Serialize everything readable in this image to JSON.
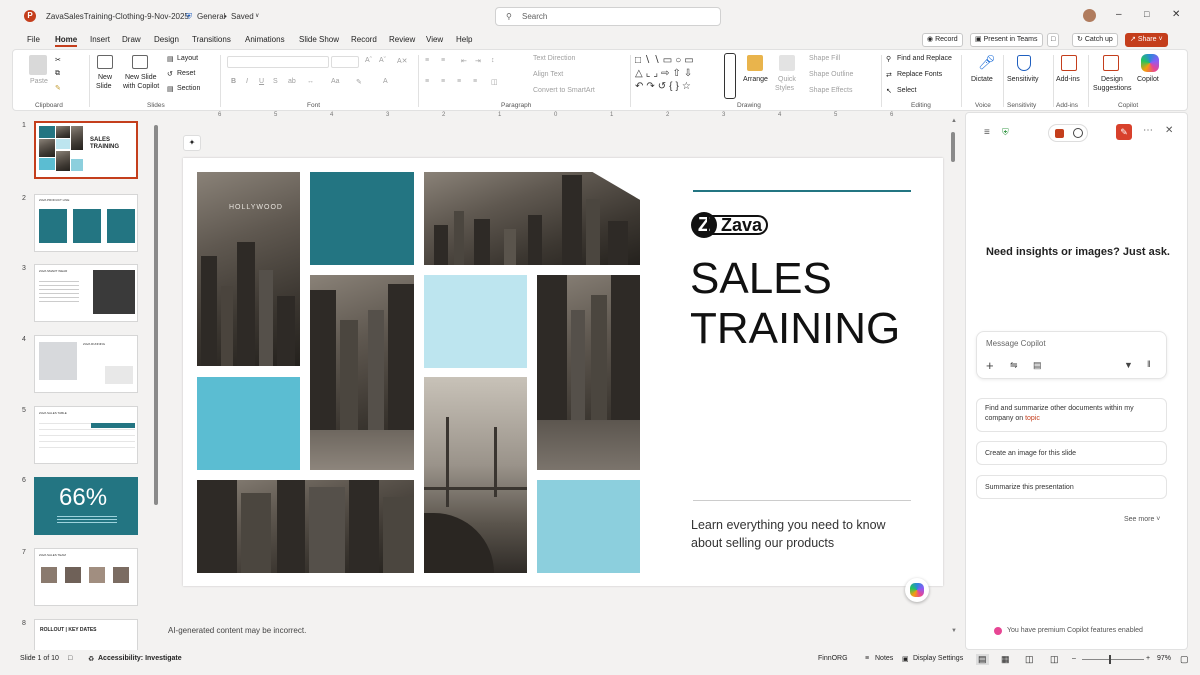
{
  "titlebar": {
    "filename": "ZavaSalesTraining-Clothing-9-Nov-2025",
    "sensitivity": "General",
    "saved": "Saved",
    "search_placeholder": "Search",
    "app_initial": "P"
  },
  "tabs": [
    "File",
    "Home",
    "Insert",
    "Draw",
    "Design",
    "Transitions",
    "Animations",
    "Slide Show",
    "Record",
    "Review",
    "View",
    "Help"
  ],
  "actions": {
    "record": "Record",
    "teams": "Present in Teams",
    "catchup": "Catch up",
    "share": "Share"
  },
  "ribbon": {
    "clipboard": {
      "paste": "Paste",
      "label": "Clipboard"
    },
    "slides": {
      "new_slide": "New",
      "new_slide2": "Slide",
      "copilot_slide": "New Slide",
      "copilot_slide2": "with Copilot",
      "layout": "Layout",
      "reset": "Reset",
      "section": "Section",
      "label": "Slides"
    },
    "font": {
      "label": "Font"
    },
    "paragraph": {
      "text_direction": "Text Direction",
      "align_text": "Align Text",
      "smartart": "Convert to SmartArt",
      "label": "Paragraph"
    },
    "drawing": {
      "arrange": "Arrange",
      "quick_styles": "Quick",
      "quick_styles2": "Styles",
      "shape_fill": "Shape Fill",
      "shape_outline": "Shape Outline",
      "shape_effects": "Shape Effects",
      "label": "Drawing"
    },
    "editing": {
      "find": "Find and Replace",
      "replace": "Replace Fonts",
      "select": "Select",
      "label": "Editing"
    },
    "voice": {
      "dictate": "Dictate",
      "label": "Voice"
    },
    "sensitivity": {
      "btn": "Sensitivity",
      "label": "Sensitivity"
    },
    "addins": {
      "btn": "Add-ins",
      "label": "Add-ins"
    },
    "copilot": {
      "designer": "Design",
      "designer2": "Suggestions",
      "copilot": "Copilot",
      "label": "Copilot"
    }
  },
  "ruler": [
    "6",
    "5",
    "4",
    "3",
    "2",
    "1",
    "0",
    "1",
    "2",
    "3",
    "4",
    "5",
    "6"
  ],
  "thumbnails": [
    {
      "num": "1",
      "title": "SALES TRAINING"
    },
    {
      "num": "2",
      "title": "ZAVA PRODUCT LINE"
    },
    {
      "num": "3",
      "title": "ZAVA SMART WEAR"
    },
    {
      "num": "4",
      "title": "ZAVA RUNNING"
    },
    {
      "num": "5",
      "title": "ZAVA SALES TABLE"
    },
    {
      "num": "6",
      "title": "66%"
    },
    {
      "num": "7",
      "title": "ZAVA SALES TEAM"
    },
    {
      "num": "8",
      "title": "ROLLOUT | KEY DATES"
    }
  ],
  "slide": {
    "brand": "Zava",
    "title_line1": "SALES",
    "title_line2": "TRAINING",
    "subtitle": "Learn everything you need to know about selling our products",
    "sign_text": "HOLLYWOOD",
    "teal": "#237582",
    "mid": "#5bbdd2",
    "light": "#bde5ef"
  },
  "ai_notice": "AI-generated content may be incorrect.",
  "copilot": {
    "heading": "Need insights or images? Just ask.",
    "input_placeholder": "Message Copilot",
    "suggestions": [
      {
        "text": "Find and summarize other documents within my company on ",
        "link": "topic"
      },
      {
        "text": "Create an image for this slide",
        "link": ""
      },
      {
        "text": "Summarize this presentation",
        "link": ""
      }
    ],
    "see_more": "See more",
    "premium": "You have premium Copilot features enabled"
  },
  "status": {
    "slide_of": "Slide 1 of 10",
    "accessibility": "Accessibility: Investigate",
    "lang": "FinnORG",
    "notes": "Notes",
    "display": "Display Settings",
    "zoom": "97%"
  }
}
